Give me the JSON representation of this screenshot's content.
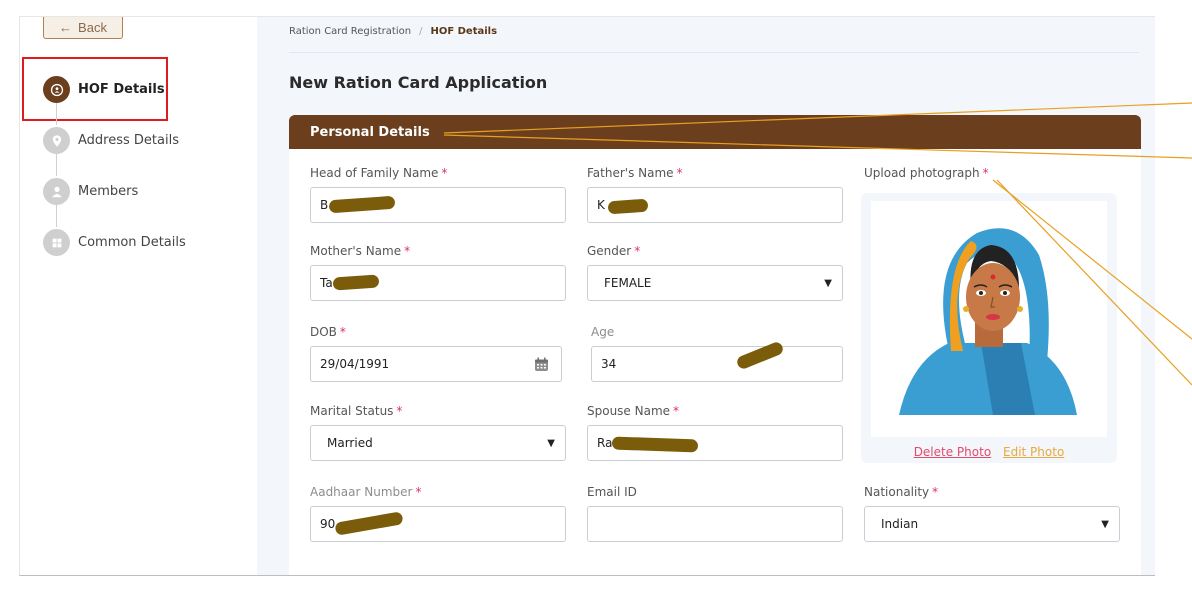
{
  "sidebar": {
    "back_label": "Back",
    "steps": [
      {
        "label": "HOF Details",
        "icon": "user-icon",
        "active": true
      },
      {
        "label": "Address Details",
        "icon": "location-pin-icon",
        "active": false
      },
      {
        "label": "Members",
        "icon": "user-icon",
        "active": false
      },
      {
        "label": "Common Details",
        "icon": "grid-icon",
        "active": false
      }
    ]
  },
  "breadcrumb": {
    "parent": "Ration Card Registration",
    "separator": "/",
    "current": "HOF Details"
  },
  "page_title": "New Ration Card Application",
  "section_title": "Personal Details",
  "required_mark": "*",
  "fields": {
    "hof_name": {
      "label": "Head of Family Name",
      "value": "B"
    },
    "father_name": {
      "label": "Father's Name",
      "value": "K"
    },
    "upload_photo": {
      "label": "Upload photograph"
    },
    "mother_name": {
      "label": "Mother's Name",
      "value": "Ta"
    },
    "gender": {
      "label": "Gender",
      "value": "FEMALE"
    },
    "dob": {
      "label": "DOB",
      "value": "29/04/1991"
    },
    "age": {
      "label": "Age",
      "value": "34"
    },
    "marital_status": {
      "label": "Marital Status",
      "value": "Married"
    },
    "spouse_name": {
      "label": "Spouse Name",
      "value": "Ra"
    },
    "aadhaar": {
      "label": "Aadhaar Number",
      "value": "90"
    },
    "email": {
      "label": "Email ID",
      "value": ""
    },
    "nationality": {
      "label": "Nationality",
      "value": "Indian"
    }
  },
  "photo_actions": {
    "delete_label": "Delete Photo",
    "edit_label": "Edit Photo"
  },
  "colors": {
    "brand": "#6b3f1d",
    "required": "#e0315a",
    "highlight": "#e01b1b",
    "annotation": "#e8a020"
  }
}
